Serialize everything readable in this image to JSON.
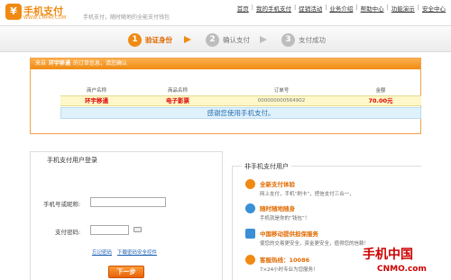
{
  "header": {
    "logo_mark": "¥",
    "logo_name": "手机支付",
    "logo_url": "WWW.CMPAY.COM",
    "tagline": "手机支付，随时随地的全能支付钱包",
    "nav": [
      "首页",
      "我的手机支付",
      "促销活动",
      "业务介绍",
      "帮助中心",
      "功能演示",
      "安全中心"
    ]
  },
  "steps": [
    {
      "num": "1",
      "label": "验证身份"
    },
    {
      "num": "2",
      "label": "确认支付"
    },
    {
      "num": "3",
      "label": "支付成功"
    }
  ],
  "order": {
    "head_prefix": "来自",
    "merchant": "环宇移通",
    "head_suffix": "的订单信息，请您确认",
    "columns": [
      "商户名称",
      "商品名称",
      "订单号",
      "金额"
    ],
    "row": {
      "merchant": "环宇移通",
      "product": "电子影票",
      "order_no": "000000000564902",
      "amount": "70.00元"
    },
    "thanks": "感谢您使用手机支付。"
  },
  "login": {
    "title": "手机支付用户登录",
    "phone_label": "手机号或昵称:",
    "phone_value": "",
    "password_label": "支付密码:",
    "password_value": "",
    "forgot_link": "忘记密码",
    "download_link": "下载密码安全控件",
    "next_button": "下一步"
  },
  "non_user": {
    "title": "非手机支付用户",
    "features": [
      {
        "title": "全新支付体验",
        "desc": "网上支付，手机“刷卡”，把信支付三合一，",
        "color": "#f08a12"
      },
      {
        "title": "随时随地随身",
        "desc": "手机就是你的“钱包”！",
        "color": "#3a8fd6"
      },
      {
        "title": "中国移动提供担保服务",
        "desc": "使您的交易更安全，资金更安全，值得您的信赖！",
        "color": "#3a8fd6"
      },
      {
        "title": "客服热线：10086",
        "desc": "7×24小时专业为您服务！",
        "color": "#f08a12"
      }
    ]
  },
  "watermark": {
    "name": "手机中国",
    "url": "CNMO.com"
  }
}
